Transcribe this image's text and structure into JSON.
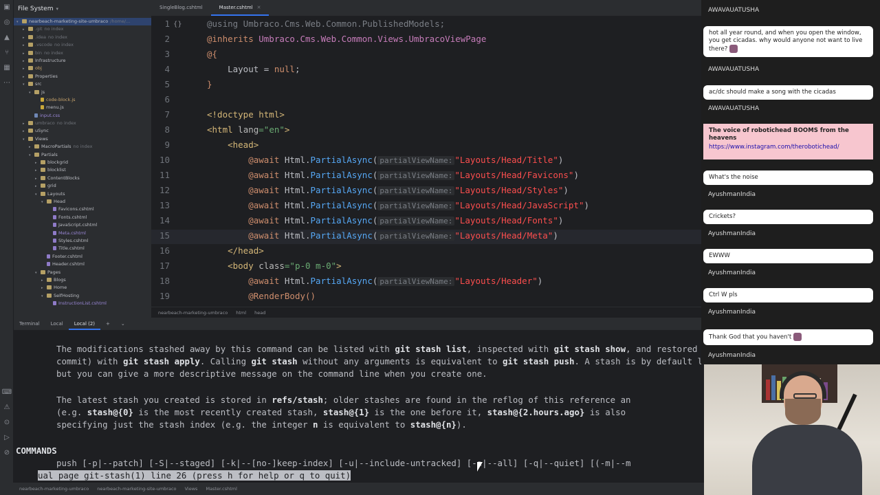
{
  "tree": {
    "title": "File System",
    "root": "nearbeach-marketing-site-umbraco",
    "root_hint": "/home/...",
    "items": [
      {
        "label": ".git",
        "hint": "no index",
        "level": 2,
        "type": "folder",
        "muted": true
      },
      {
        "label": ".idea",
        "hint": "no index",
        "level": 2,
        "type": "folder",
        "muted": true
      },
      {
        "label": ".vscode",
        "hint": "no index",
        "level": 2,
        "type": "folder",
        "muted": true
      },
      {
        "label": "bin",
        "hint": "no index",
        "level": 2,
        "type": "folder",
        "muted": true
      },
      {
        "label": "Infrastructure",
        "hint": "",
        "level": 2,
        "type": "folder"
      },
      {
        "label": "obj",
        "hint": "",
        "level": 2,
        "type": "folder",
        "amber": true
      },
      {
        "label": "Properties",
        "hint": "",
        "level": 2,
        "type": "folder"
      },
      {
        "label": "src",
        "hint": "",
        "level": 2,
        "type": "folder",
        "open": true
      },
      {
        "label": "js",
        "hint": "",
        "level": 3,
        "type": "folder",
        "open": true
      },
      {
        "label": "code-block.js",
        "hint": "",
        "level": 4,
        "type": "js",
        "amber": true
      },
      {
        "label": "menu.js",
        "hint": "",
        "level": 4,
        "type": "js"
      },
      {
        "label": "input.css",
        "hint": "",
        "level": 3,
        "type": "css",
        "purple": true
      },
      {
        "label": "umbraco",
        "hint": "no index",
        "level": 2,
        "type": "folder",
        "muted": true
      },
      {
        "label": "uSync",
        "hint": "",
        "level": 2,
        "type": "folder"
      },
      {
        "label": "Views",
        "hint": "",
        "level": 2,
        "type": "folder",
        "open": true
      },
      {
        "label": "MacroPartials",
        "hint": "no index",
        "level": 3,
        "type": "folder"
      },
      {
        "label": "Partials",
        "hint": "",
        "level": 3,
        "type": "folder",
        "open": true
      },
      {
        "label": "blockgrid",
        "hint": "",
        "level": 4,
        "type": "folder"
      },
      {
        "label": "blocklist",
        "hint": "",
        "level": 4,
        "type": "folder"
      },
      {
        "label": "ContentBlocks",
        "hint": "",
        "level": 4,
        "type": "folder"
      },
      {
        "label": "grid",
        "hint": "",
        "level": 4,
        "type": "folder"
      },
      {
        "label": "Layouts",
        "hint": "",
        "level": 4,
        "type": "folder",
        "open": true
      },
      {
        "label": "Head",
        "hint": "",
        "level": 5,
        "type": "folder",
        "open": true
      },
      {
        "label": "Favicons.cshtml",
        "hint": "",
        "level": 6,
        "type": "cs"
      },
      {
        "label": "Fonts.cshtml",
        "hint": "",
        "level": 6,
        "type": "cs"
      },
      {
        "label": "JavaScript.cshtml",
        "hint": "",
        "level": 6,
        "type": "cs"
      },
      {
        "label": "Meta.cshtml",
        "hint": "",
        "level": 6,
        "type": "cs",
        "purple": true
      },
      {
        "label": "Styles.cshtml",
        "hint": "",
        "level": 6,
        "type": "cs"
      },
      {
        "label": "Title.cshtml",
        "hint": "",
        "level": 6,
        "type": "cs"
      },
      {
        "label": "Footer.cshtml",
        "hint": "",
        "level": 5,
        "type": "cs"
      },
      {
        "label": "Header.cshtml",
        "hint": "",
        "level": 5,
        "type": "cs"
      },
      {
        "label": "Pages",
        "hint": "",
        "level": 4,
        "type": "folder",
        "open": true
      },
      {
        "label": "Blogs",
        "hint": "",
        "level": 5,
        "type": "folder"
      },
      {
        "label": "Home",
        "hint": "",
        "level": 5,
        "type": "folder"
      },
      {
        "label": "SelfHosting",
        "hint": "",
        "level": 5,
        "type": "folder",
        "open": true
      },
      {
        "label": "InstructionList.cshtml",
        "hint": "",
        "level": 6,
        "type": "cs",
        "purple": true
      }
    ]
  },
  "editor": {
    "tabs": [
      {
        "label": "SingleBlog.cshtml",
        "active": false
      },
      {
        "label": "Master.cshtml",
        "active": true
      }
    ],
    "line_numbers": [
      "1",
      "2",
      "3",
      "4",
      "5",
      "6",
      "7",
      "8",
      "9",
      "10",
      "11",
      "12",
      "13",
      "14",
      "15",
      "16",
      "17",
      "18",
      "19"
    ],
    "lines": {
      "l1_kw": "@using",
      "l1_ns": " Umbraco.Cms.Web.Common.PublishedModels;",
      "l2_kw": "@inherits",
      "l2_ns": " Umbraco.Cms.Web.Common.Views.UmbracoViewPage",
      "l3": "@{",
      "l4_a": "    Layout",
      "l4_b": " = ",
      "l4_c": "null",
      "l4_d": ";",
      "l5": "}",
      "l7": "<!doctype html>",
      "l8_tag": "<html",
      "l8_attr": " lang",
      "l8_val": "=\"en\"",
      "l8_end": ">",
      "l9": "    <head>",
      "await": "@await",
      "html_call": " Html.",
      "method": "PartialAsync",
      "param_hint": "partialViewName:",
      "head_paths": [
        "\"Layouts/Head/Title\"",
        "\"Layouts/Head/Favicons\"",
        "\"Layouts/Head/Styles\"",
        "\"Layouts/Head/JavaScript\"",
        "\"Layouts/Head/Fonts\"",
        "\"Layouts/Head/Meta\""
      ],
      "l16": "    </head>",
      "l17_tag": "    <body",
      "l17_attr": " class",
      "l17_val": "=\"p-0 m-0\"",
      "l17_end": ">",
      "l18_path": "\"Layouts/Header\"",
      "l19": "@RenderBody()"
    },
    "breadcrumb": [
      "nearbeach-marketing-umbraco",
      "html",
      "head"
    ]
  },
  "terminal": {
    "tabs": [
      "Terminal",
      "Local",
      "Local (2)"
    ],
    "add": "+",
    "lines": [
      {
        "parts": [
          [
            "The modifications stashed away by this command can be listed with ",
            false
          ],
          [
            "git stash list",
            true
          ],
          [
            ", inspected with ",
            false
          ],
          [
            "git stash show",
            true
          ],
          [
            ", and restored (potentially on t",
            false
          ]
        ]
      },
      {
        "parts": [
          [
            "commit) with ",
            false
          ],
          [
            "git stash apply",
            true
          ],
          [
            ". Calling ",
            false
          ],
          [
            "git stash",
            true
          ],
          [
            " without any arguments is equivalent to ",
            false
          ],
          [
            "git stash push",
            true
          ],
          [
            ". A stash is by default listed as \"WIP on",
            false
          ]
        ]
      },
      {
        "parts": [
          [
            "but you can give a more descriptive message on the command line when you create one.",
            false
          ]
        ]
      },
      {
        "parts": [
          [
            "The latest stash you created is stored in ",
            false
          ],
          [
            "refs/stash",
            true
          ],
          [
            "; older stashes are found in the reflog of this reference an",
            false
          ]
        ]
      },
      {
        "parts": [
          [
            "(e.g. ",
            false
          ],
          [
            "stash@{0}",
            true
          ],
          [
            " is the most recently created stash, ",
            false
          ],
          [
            "stash@{1}",
            true
          ],
          [
            " is the one before it, ",
            false
          ],
          [
            "stash@{2.hours.ago}",
            true
          ],
          [
            " is also",
            false
          ]
        ]
      },
      {
        "parts": [
          [
            "specifying just the stash index (e.g. the integer ",
            false
          ],
          [
            "n",
            true
          ],
          [
            " is equivalent to ",
            false
          ],
          [
            "stash@{n}",
            true
          ],
          [
            ").",
            false
          ]
        ]
      }
    ],
    "section": "COMMANDS",
    "push_line": "push [-p|--patch] [-S|--staged] [-k|--[no-]keep-index] [-u|--include-untracked] [-a|--all] [-q|--quiet] [(-m|--m",
    "pager": "ual page git-stash(1) line 26 (press h for help or q to quit)"
  },
  "statusbar": [
    "nearbeach-marketing-umbraco",
    "nearbeach-marketing-site-umbraco",
    "Views",
    "Master.cshtml"
  ],
  "chat": {
    "messages": [
      {
        "user": "AWAVAUATUSHA",
        "text": ""
      },
      {
        "text": "hot all year round, and when you open the window, you get cicadas. why would anyone not want to live there?",
        "user": "AWAVAUATUSHA"
      },
      {
        "text": "ac/dc should make a song with the cicadas",
        "user": "AWAVAUATUSHA"
      },
      {
        "title": "The voice of robotichead BOOMS from the heavens",
        "link": "https://www.instagram.com/therobotichead/"
      },
      {
        "text": "What's the noise",
        "user": "AyushmanIndia"
      },
      {
        "text": "Crickets?",
        "user": "AyushmanIndia"
      },
      {
        "text": "EWWW",
        "user": "AyushmanIndia"
      },
      {
        "text": "Ctrl W pls",
        "user": "AyushmanIndia"
      },
      {
        "text": "Thank God that you haven't",
        "user": "AyushmanIndia"
      }
    ]
  }
}
